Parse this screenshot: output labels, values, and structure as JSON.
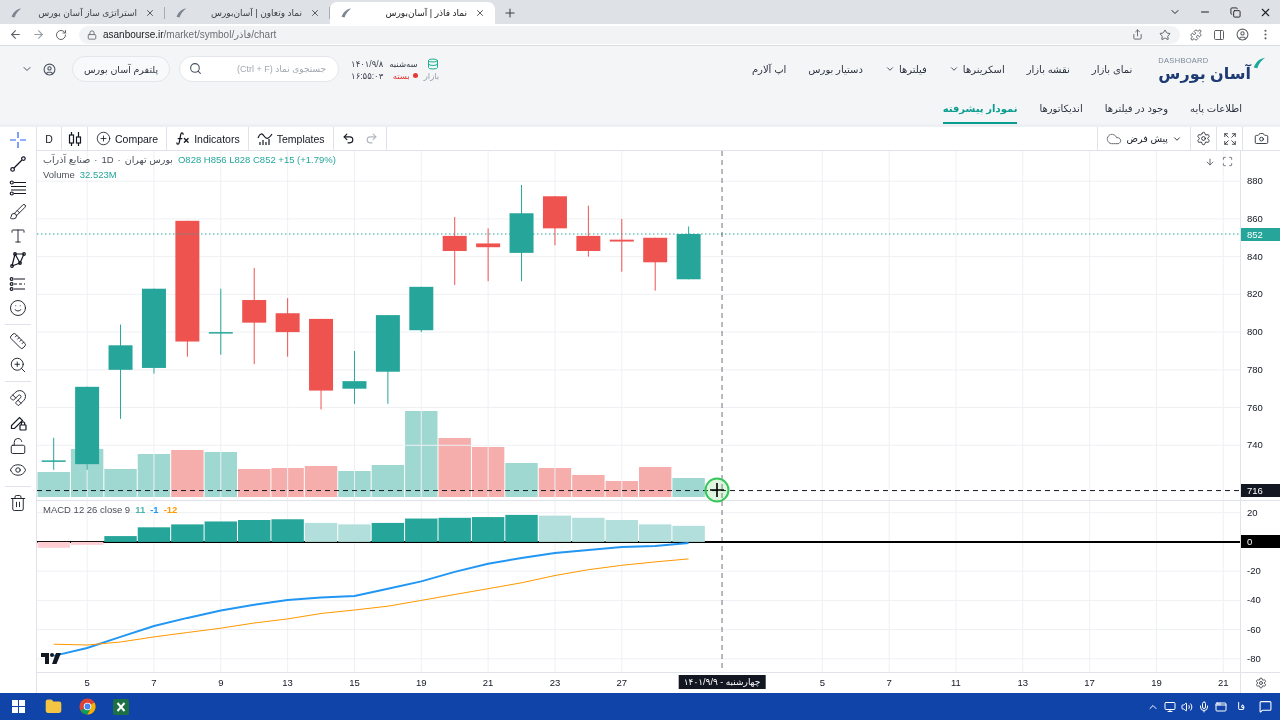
{
  "browser": {
    "tabs": [
      {
        "title": "نماد فاذر | آسان‌بورس",
        "selected": true
      },
      {
        "title": "نماد وتعاون | آسان‌بورس",
        "selected": false
      },
      {
        "title": "استراتژی ساز آسان بورس",
        "selected": false
      }
    ],
    "url": {
      "host": "asanbourse.ir",
      "path": "/market/symbol/فاذر/chart"
    }
  },
  "site_header": {
    "logo": {
      "subtitle": "DASHBOARD",
      "name": "آسان بورس"
    },
    "nav": [
      {
        "label": "نمای بازار",
        "dropdown": false
      },
      {
        "label": "نقشه بازار",
        "dropdown": false
      },
      {
        "label": "اسکرینرها",
        "dropdown": true
      },
      {
        "label": "فیلترها",
        "dropdown": true
      },
      {
        "label": "دستیار بورس",
        "dropdown": false
      },
      {
        "label": "اپ آلارم",
        "dropdown": false
      }
    ],
    "market": {
      "weekday": "سه‌شنبه",
      "date": "۱۴۰۱/۹/۸",
      "label": "بازار",
      "status": "بسته",
      "open": false,
      "time": "۱۶:۵۵:۰۳"
    },
    "search": {
      "placeholder": "جستجوی نماد (Ctrl + F)"
    },
    "platform_button": "پلتفرم آسان بورس"
  },
  "subnav": [
    {
      "label": "اطلاعات پایه",
      "selected": false
    },
    {
      "label": "وجود در فیلترها",
      "selected": false
    },
    {
      "label": "اندیکاتورها",
      "selected": false
    },
    {
      "label": "نمودار پیشرفته",
      "selected": true
    }
  ],
  "drawing_tools": [
    {
      "tools": [
        {
          "kind": "crosshair",
          "selected": true
        },
        {
          "kind": "trend_line",
          "selected": false
        },
        {
          "kind": "fib",
          "selected": false
        },
        {
          "kind": "brush",
          "selected": false
        },
        {
          "kind": "text",
          "selected": false
        },
        {
          "kind": "pattern",
          "selected": false
        },
        {
          "kind": "forecast",
          "selected": false
        },
        {
          "kind": "emoji",
          "selected": false
        }
      ]
    },
    {
      "tools": [
        {
          "kind": "ruler",
          "selected": false
        },
        {
          "kind": "zoom",
          "selected": false
        }
      ]
    },
    {
      "tools": [
        {
          "kind": "magnet",
          "selected": false
        },
        {
          "kind": "lock_drawings",
          "selected": false
        },
        {
          "kind": "lock",
          "selected": false
        },
        {
          "kind": "visibility",
          "selected": false
        }
      ]
    },
    {
      "tools": [
        {
          "kind": "trash",
          "selected": false
        }
      ]
    }
  ],
  "chart_toolbar": {
    "interval": "D",
    "tools": [
      {
        "kind": "templates",
        "label": "Templates"
      },
      {
        "kind": "indicators",
        "label": "Indicators"
      },
      {
        "kind": "compare",
        "label": "Compare"
      }
    ],
    "history": [
      {
        "kind": "undo",
        "disabled": false
      },
      {
        "kind": "redo",
        "disabled": true
      }
    ],
    "layout": "پیش فرض"
  },
  "legend": {
    "title": [
      "بورس تهران",
      "·",
      "1D",
      "·",
      "صنایع آذرآب"
    ],
    "values": "O828 H856 L828 C852 +15 (+1.79%)",
    "volume_label": "Volume",
    "volume_value": "32.523M"
  },
  "macd_legend": {
    "title": "MACD 12 26 close 9",
    "values": [
      {
        "text": "-12",
        "color": "#ff9800"
      },
      {
        "text": "-1",
        "color": "#2196f3"
      },
      {
        "text": "11",
        "color": "#4db6ac"
      }
    ]
  },
  "chart": {
    "crosshair": {
      "date_label": "چهارشنبه - ۱۴۰۱/۹/۹"
    },
    "chart_data": [
      {
        "type": "candlestick",
        "categories": [
          null,
          null,
          null,
          null,
          null,
          null,
          null,
          null,
          null,
          null,
          null,
          null,
          null,
          null,
          null,
          null,
          null,
          null,
          null,
          null,
          null,
          null,
          null,
          null,
          null,
          null,
          null,
          null,
          null,
          null,
          null,
          null,
          null,
          null,
          null,
          null
        ],
        "ohlc": [
          [
            732,
            744,
            727,
            732
          ],
          [
            730,
            771,
            727,
            771
          ],
          [
            780,
            804,
            754,
            793
          ],
          [
            781,
            823,
            778,
            823
          ],
          [
            859,
            859,
            787,
            795
          ],
          [
            800,
            823,
            788,
            800
          ],
          [
            817,
            834,
            783,
            805
          ],
          [
            810,
            818,
            787,
            800
          ],
          [
            807,
            807,
            759,
            769
          ],
          [
            770,
            790,
            762,
            774
          ],
          [
            779,
            809,
            762,
            809
          ],
          [
            801,
            824,
            800,
            824
          ],
          [
            851,
            861,
            825,
            843
          ],
          [
            847,
            855,
            827,
            845
          ],
          [
            842,
            878,
            827,
            863
          ],
          [
            872,
            872,
            846,
            855
          ],
          [
            851,
            867,
            840,
            843
          ],
          [
            849,
            860,
            832,
            848
          ],
          [
            850,
            850,
            822,
            837
          ],
          [
            828,
            856,
            828,
            852
          ],
          null,
          null,
          null,
          null,
          null,
          null,
          null,
          null,
          null,
          null,
          null,
          null,
          null,
          null,
          null,
          null
        ],
        "ylim": [
          711,
          896
        ],
        "yticks": [
          740,
          760,
          780,
          800,
          820,
          840,
          860,
          880
        ],
        "tick_labels": "y",
        "grid": true,
        "ref_lines": [
          {
            "axis": "y",
            "value": 852,
            "label": "852",
            "color": "#26a69a",
            "line_style": "dotted"
          },
          {
            "axis": "y",
            "value": 716,
            "label": "716",
            "color": "#131722",
            "line_style": "dashed"
          }
        ]
      },
      {
        "type": "bar",
        "categories": [
          null,
          "5",
          null,
          "7",
          null,
          "9",
          null,
          "13",
          null,
          "15",
          null,
          "19",
          null,
          "21",
          null,
          "23",
          null,
          "27",
          null,
          null,
          null,
          null,
          null,
          "5",
          null,
          "7",
          null,
          "11",
          null,
          "13",
          null,
          "17",
          null,
          "19",
          null,
          "21"
        ],
        "series": [
          {
            "type": "bar",
            "colors": [
              "#ffcdd2",
              "#ffcdd2",
              "#26a69a",
              "#26a69a",
              "#26a69a",
              "#26a69a",
              "#26a69a",
              "#26a69a",
              "#b2dfdb",
              "#b2dfdb",
              "#26a69a",
              "#26a69a",
              "#26a69a",
              "#26a69a",
              "#26a69a",
              "#b2dfdb",
              "#b2dfdb",
              "#b2dfdb",
              "#b2dfdb",
              "#b2dfdb",
              null,
              null,
              null,
              null,
              null,
              null,
              null,
              null,
              null,
              null,
              null,
              null,
              null,
              null,
              null,
              null
            ],
            "values": [
              -4,
              -2,
              4,
              10,
              12,
              14,
              15,
              15.5,
              13,
              12,
              13,
              16,
              16.5,
              17,
              18.5,
              18,
              16.5,
              15,
              12,
              11,
              null,
              null,
              null,
              null,
              null,
              null,
              null,
              null,
              null,
              null,
              null,
              null,
              null,
              null,
              null,
              null
            ]
          },
          {
            "type": "line",
            "color": "#2196f3",
            "values": [
              -78,
              -72.6,
              -65,
              -57.5,
              -52,
              -47,
              -43,
              -39.7,
              -38,
              -37,
              -32,
              -27,
              -20.5,
              -15,
              -11,
              -7.5,
              -5.5,
              -3.4,
              -2.7,
              -0.7,
              null,
              null,
              null,
              null,
              null,
              null,
              null,
              null,
              null,
              null,
              null,
              null,
              null,
              null,
              null,
              null
            ]
          },
          {
            "type": "line",
            "color": "#ff9800",
            "values": [
              -70,
              -70.5,
              -68.5,
              -65,
              -62,
              -59,
              -55.5,
              -52.7,
              -49,
              -46.6,
              -44,
              -40,
              -36,
              -32,
              -28,
              -23,
              -19,
              -16,
              -13.7,
              -11.6,
              null,
              null,
              null,
              null,
              null,
              null,
              null,
              null,
              null,
              null,
              null,
              null,
              null,
              null,
              null,
              null
            ]
          }
        ],
        "ylim": [
          -89,
          28
        ],
        "yticks": [
          20,
          -20,
          -40,
          -60,
          -80
        ],
        "grid": true,
        "ref_lines": [
          {
            "axis": "y",
            "value": 0,
            "label": "0",
            "color": "#000000",
            "line_style": "solid"
          }
        ]
      }
    ]
  },
  "taskbar": {
    "language": "فا"
  }
}
